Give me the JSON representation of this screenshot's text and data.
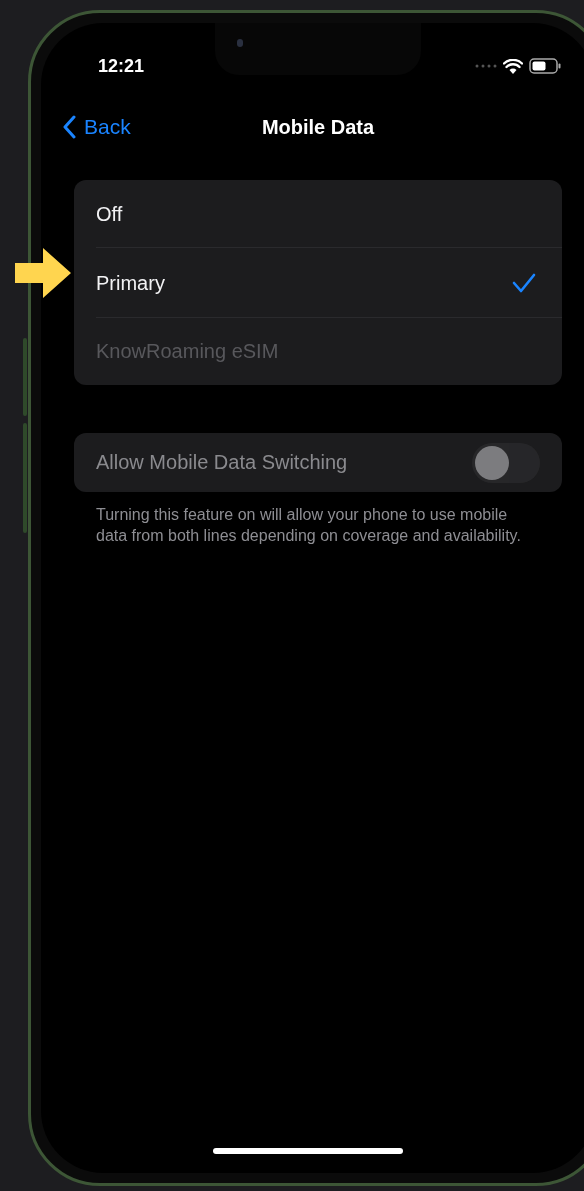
{
  "status_bar": {
    "time": "12:21"
  },
  "nav": {
    "back": "Back",
    "title": "Mobile Data"
  },
  "options": [
    {
      "label": "Off",
      "selected": false,
      "disabled": false
    },
    {
      "label": "Primary",
      "selected": true,
      "disabled": false
    },
    {
      "label": "KnowRoaming eSIM",
      "selected": false,
      "disabled": true
    }
  ],
  "switch_row": {
    "label": "Allow Mobile Data Switching",
    "on": false,
    "disabled": true
  },
  "footer": "Turning this feature on will allow your phone to use mobile data from both lines depending on coverage and availability."
}
